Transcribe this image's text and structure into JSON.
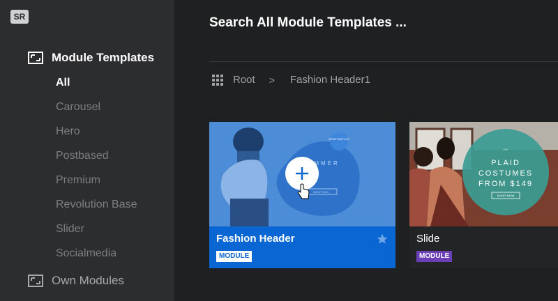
{
  "sidebar": {
    "logo": "SR",
    "section_main": {
      "label": "Module Templates",
      "icon": "module-icon"
    },
    "items": [
      {
        "label": "All",
        "active": true
      },
      {
        "label": "Carousel"
      },
      {
        "label": "Hero"
      },
      {
        "label": "Postbased"
      },
      {
        "label": "Premium"
      },
      {
        "label": "Revolution Base"
      },
      {
        "label": "Slider"
      },
      {
        "label": "Socialmedia"
      }
    ],
    "section_own": {
      "label": "Own Modules",
      "icon": "module-icon"
    }
  },
  "search": {
    "title": "Search All Module Templates ..."
  },
  "breadcrumb": {
    "icon": "grid-icon",
    "root": "Root",
    "separator": ">",
    "current": "Fashion Header1"
  },
  "cards": [
    {
      "title": "Fashion Header",
      "badge": "MODULE",
      "thumb_text": {
        "circle": "SUMMER",
        "small": "SHOP NOW",
        "tag": "SHOP WITH US"
      },
      "hover_icon": "plus-icon",
      "star_icon": "star-icon"
    },
    {
      "title": "Slide",
      "badge": "MODULE",
      "thumb_text": {
        "line1": "PLAID",
        "line2": "COSTUMES",
        "line3": "FROM $149",
        "small": "SHOP NOW"
      }
    }
  ],
  "colors": {
    "sidebar_bg": "#2c2d2f",
    "main_bg": "#1f2021",
    "accent_blue": "#0a66d3",
    "badge_purple": "#6b3fb6"
  }
}
